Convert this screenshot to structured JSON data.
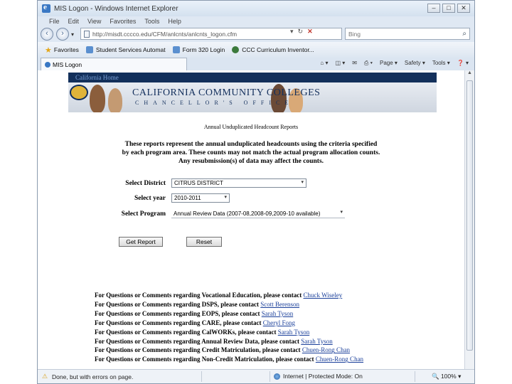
{
  "window": {
    "title": "MIS Logon - Windows Internet Explorer",
    "controls": [
      "–",
      "□",
      "✕"
    ]
  },
  "menu": [
    "File",
    "Edit",
    "View",
    "Favorites",
    "Tools",
    "Help"
  ],
  "address": {
    "url": "http://misdt.cccco.edu/CFM/anlcnts/anlcnts_logon.cfm",
    "search_placeholder": "Bing"
  },
  "favorites": {
    "label": "Favorites",
    "items": [
      "Student Services Automat",
      "Form 320 Login",
      "CCC Curriculum Inventor..."
    ]
  },
  "tab": {
    "label": "MIS Logon"
  },
  "commands": [
    "Page",
    "Safety",
    "Tools"
  ],
  "site": {
    "home_link": "California Home",
    "banner_title": "CALIFORNIA COMMUNITY COLLEGES",
    "banner_subtitle": "CHANCELLOR'S OFFICE"
  },
  "page": {
    "heading": "Annual Unduplicated Headcount Reports",
    "intro": [
      "These reports represent the annual unduplicated headcounts using the criteria specified",
      "by each program area. These counts may not match the actual program allocation counts.",
      "Any resubmission(s) of data may affect the counts."
    ]
  },
  "form": {
    "district_label": "Select District",
    "district_value": "CITRUS DISTRICT",
    "year_label": "Select year",
    "year_value": "2010-2011",
    "program_label": "Select Program",
    "program_value": "Annual Review Data (2007-08,2008-09,2009-10 available)",
    "submit": "Get Report",
    "reset": "Reset"
  },
  "contacts": [
    {
      "text": "For Questions or Comments regarding Vocational Education, please contact ",
      "name": "Chuck Wiseley"
    },
    {
      "text": "For Questions or Comments regarding DSPS, please contact ",
      "name": "Scott Berenson"
    },
    {
      "text": "For Questions or Comments regarding EOPS, please contact ",
      "name": "Sarah Tyson"
    },
    {
      "text": "For Questions or Comments regarding CARE, please contact ",
      "name": "Cheryl Fong"
    },
    {
      "text": "For Questions or Comments regarding CalWORKs, please contact ",
      "name": "Sarah Tyson"
    },
    {
      "text": "For Questions or Comments regarding Annual Review Data, please contact ",
      "name": "Sarah Tyson"
    },
    {
      "text": "For Questions or Comments regarding Credit Matriculation, please contact ",
      "name": "Chuen-Rong Chan"
    },
    {
      "text": "For Questions or Comments regarding Non-Credit Matriculation, please contact ",
      "name": "Chuen-Rong Chan"
    }
  ],
  "status": {
    "text": "Done, but with errors on page.",
    "zone": "Internet | Protected Mode: On",
    "zoom": "100%"
  }
}
